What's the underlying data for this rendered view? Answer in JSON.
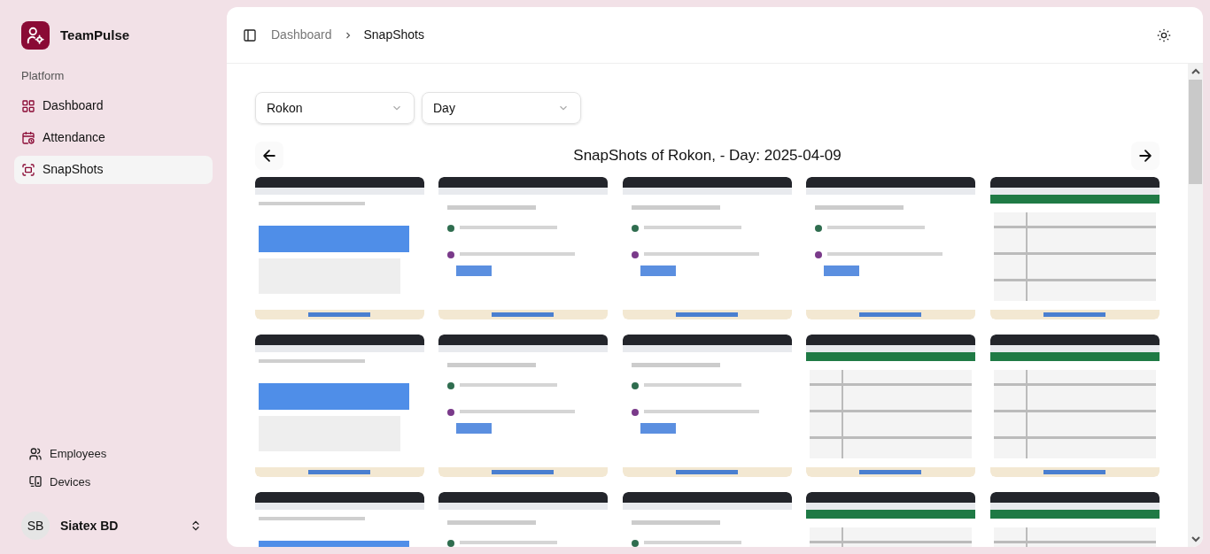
{
  "app": {
    "name": "TeamPulse"
  },
  "sidebar": {
    "section": "Platform",
    "items": [
      {
        "label": "Dashboard",
        "selected": false
      },
      {
        "label": "Attendance",
        "selected": false
      },
      {
        "label": "SnapShots",
        "selected": true
      }
    ],
    "secondary_items": [
      {
        "label": "Employees"
      },
      {
        "label": "Devices"
      }
    ],
    "user": {
      "initials": "SB",
      "name": "Siatex BD"
    }
  },
  "breadcrumb": [
    {
      "label": "Dashboard",
      "current": false
    },
    {
      "label": "SnapShots",
      "current": true
    }
  ],
  "filters": [
    {
      "value": "Rokon"
    },
    {
      "value": "Day"
    }
  ],
  "gallery_title": "SnapShots of Rokon, - Day: 2025-04-09"
}
